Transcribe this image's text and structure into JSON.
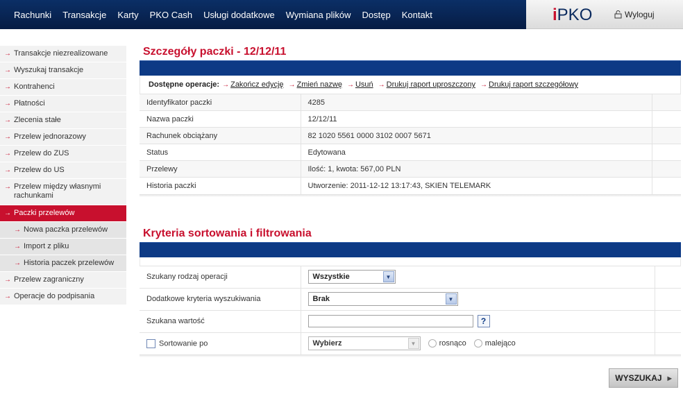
{
  "topnav": {
    "items": [
      "Rachunki",
      "Transakcje",
      "Karty",
      "PKO Cash",
      "Usługi dodatkowe",
      "Wymiana plików",
      "Dostęp",
      "Kontakt"
    ],
    "logo_mark": "i",
    "logo_text": "PKO",
    "logout_label": "Wyloguj"
  },
  "sidebar": {
    "items": [
      {
        "label": "Transakcje niezrealizowane"
      },
      {
        "label": "Wyszukaj transakcje"
      },
      {
        "label": "Kontrahenci"
      },
      {
        "label": "Płatności"
      },
      {
        "label": "Zlecenia stałe"
      },
      {
        "label": "Przelew jednorazowy"
      },
      {
        "label": "Przelew do ZUS"
      },
      {
        "label": "Przelew do US"
      },
      {
        "label": "Przelew między własnymi rachunkami"
      },
      {
        "label": "Paczki przelewów"
      },
      {
        "label": "Nowa paczka przelewów"
      },
      {
        "label": "Import z pliku"
      },
      {
        "label": "Historia paczek przelewów"
      },
      {
        "label": "Przelew zagraniczny"
      },
      {
        "label": "Operacje do podpisania"
      }
    ]
  },
  "details": {
    "title": "Szczegóły paczki - 12/12/11",
    "ops_label": "Dostępne operacje:",
    "operations": [
      "Zakończ edycję",
      "Zmień nazwę",
      "Usuń",
      "Drukuj raport uproszczony",
      "Drukuj raport szczegółowy"
    ],
    "rows": [
      {
        "label": "Identyfikator paczki",
        "value": "4285"
      },
      {
        "label": "Nazwa paczki",
        "value": "12/12/11"
      },
      {
        "label": "Rachunek obciążany",
        "value": "82 1020 5561 0000 3102 0007 5671"
      },
      {
        "label": "Status",
        "value": "Edytowana"
      },
      {
        "label": "Przelewy",
        "value": "Ilość: 1, kwota: 567,00 PLN"
      },
      {
        "label": "Historia paczki",
        "value": "Utworzenie: 2011-12-12 13:17:43, SKIEN TELEMARK"
      }
    ]
  },
  "filters": {
    "title": "Kryteria sortowania i filtrowania",
    "operation_type": {
      "label": "Szukany rodzaj operacji",
      "value": "Wszystkie"
    },
    "extra_criteria": {
      "label": "Dodatkowe kryteria wyszukiwania",
      "value": "Brak"
    },
    "search_value": {
      "label": "Szukana wartość",
      "value": "",
      "help": "?"
    },
    "sort": {
      "label": "Sortowanie po",
      "value": "Wybierz",
      "asc_label": "rosnąco",
      "desc_label": "malejąco"
    }
  },
  "search_button": {
    "label": "WYSZUKAJ"
  },
  "colors": {
    "brand_red": "#c8102e",
    "brand_navy": "#0d3a85"
  }
}
